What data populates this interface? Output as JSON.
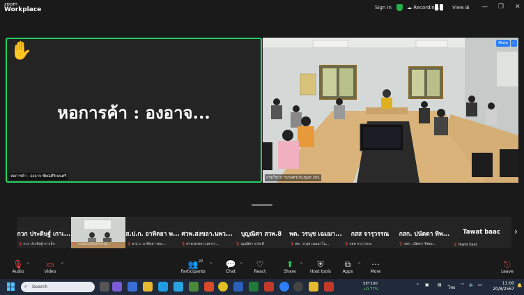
{
  "titlebar": {
    "logo_line1": "zoom",
    "logo_line2": "Workplace",
    "signin": "Sign in",
    "recording": "Recording...",
    "view": "View",
    "minimize": "—",
    "restore": "❐",
    "close": "✕"
  },
  "main": {
    "left_tile": {
      "display_name": "หอการค้า : องอาจ...",
      "label": "หอการค้า : องอาจ ชัยณศิริเนนตรี",
      "hand_raised": true
    },
    "right_tile": {
      "label": "กรมวิชาการเกษตรประชุมห 201",
      "mute_label": "Mute",
      "more_label": "···"
    }
  },
  "strip": {
    "thumbnails": [
      {
        "name": "กวก ประดิษฐ์ เกาเ...",
        "sub": "กวก ประดิษฐ์ เกาเล็ก",
        "video": false
      },
      {
        "name": "",
        "sub": "กรมส่งเสริมสหกรณ์...",
        "video": true
      },
      {
        "name": "ส.ป.ก. อาทิตยา พ...",
        "sub": "ส.ป.ก. อาทิตยา พอง...",
        "video": false
      },
      {
        "name": "ศวพ.สงขลา.นพว...",
        "sub": "ศวพ.สงขลา.นพวรร...",
        "video": false
      },
      {
        "name": "บุญณิศา สวพ.8",
        "sub": "บุญณิศา สวพ.8",
        "video": false
      },
      {
        "name": "พด. วรนุช เฉมมา...",
        "sub": "พด. วรนุช เฉมมาโน...",
        "video": false
      },
      {
        "name": "กสส จารุวรรณ",
        "sub": "กสส จารุวรรณ",
        "video": false
      },
      {
        "name": "กสก. ปนัดดา ทิพ...",
        "sub": "กสก. ปนัดดา ทิพยะ...",
        "video": false
      },
      {
        "name": "Tawat baac",
        "sub": "Tawat baac",
        "video": false
      }
    ],
    "next_icon": "›"
  },
  "toolbar": {
    "audio": "Audio",
    "video": "Video",
    "participants": "Participants",
    "participants_count": "22",
    "chat": "Chat",
    "react": "React",
    "share": "Share",
    "host_tools": "Host tools",
    "apps": "Apps",
    "more": "More",
    "leave": "Leave"
  },
  "taskbar": {
    "search_placeholder": "Search",
    "stock_name": "SET100",
    "stock_change": "+0.77%",
    "lang": "ไทย",
    "time": "11:00",
    "date": "20/8/2567"
  },
  "colors": {
    "active_speaker_border": "#23d160",
    "mute_button": "#2d7ff9",
    "muted_icon": "#ff4d4d",
    "share_green": "#23d160"
  }
}
